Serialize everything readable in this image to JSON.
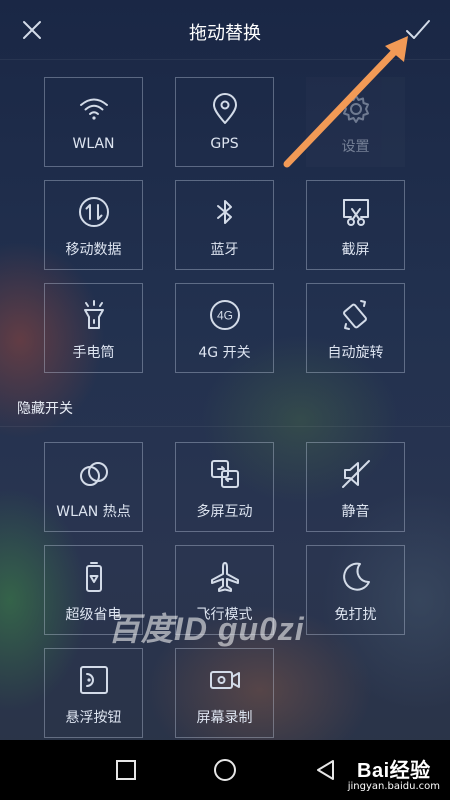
{
  "header": {
    "title": "拖动替换",
    "close_icon": "close-icon",
    "confirm_icon": "check-icon"
  },
  "active_toggles": [
    {
      "label": "WLAN",
      "icon": "wifi-icon"
    },
    {
      "label": "GPS",
      "icon": "location-pin-icon"
    },
    {
      "label": "设置",
      "icon": "gear-icon",
      "state": "dragging"
    },
    {
      "label": "移动数据",
      "icon": "mobile-data-icon"
    },
    {
      "label": "蓝牙",
      "icon": "bluetooth-icon"
    },
    {
      "label": "截屏",
      "icon": "screenshot-icon"
    },
    {
      "label": "手电筒",
      "icon": "flashlight-icon"
    },
    {
      "label": "4G 开关",
      "icon": "4g-icon"
    },
    {
      "label": "自动旋转",
      "icon": "rotate-icon"
    }
  ],
  "hidden_section": {
    "title": "隐藏开关",
    "items": [
      {
        "label": "WLAN 热点",
        "icon": "hotspot-icon"
      },
      {
        "label": "多屏互动",
        "icon": "multi-screen-icon"
      },
      {
        "label": "静音",
        "icon": "mute-icon"
      },
      {
        "label": "超级省电",
        "icon": "battery-saver-icon"
      },
      {
        "label": "飞行模式",
        "icon": "airplane-icon"
      },
      {
        "label": "免打扰",
        "icon": "moon-icon"
      },
      {
        "label": "悬浮按钮",
        "icon": "floating-button-icon"
      },
      {
        "label": "屏幕录制",
        "icon": "screen-record-icon"
      }
    ]
  },
  "watermark": "百度ID gu0zi",
  "logo": {
    "brand": "Bai经验",
    "url": "jingyan.baidu.com"
  },
  "navbar": {
    "icons": [
      "back-icon",
      "home-icon",
      "recents-icon"
    ]
  },
  "colors": {
    "arrow": "#f29a56",
    "background": "#1d2c4a",
    "navbar": "#000000"
  }
}
